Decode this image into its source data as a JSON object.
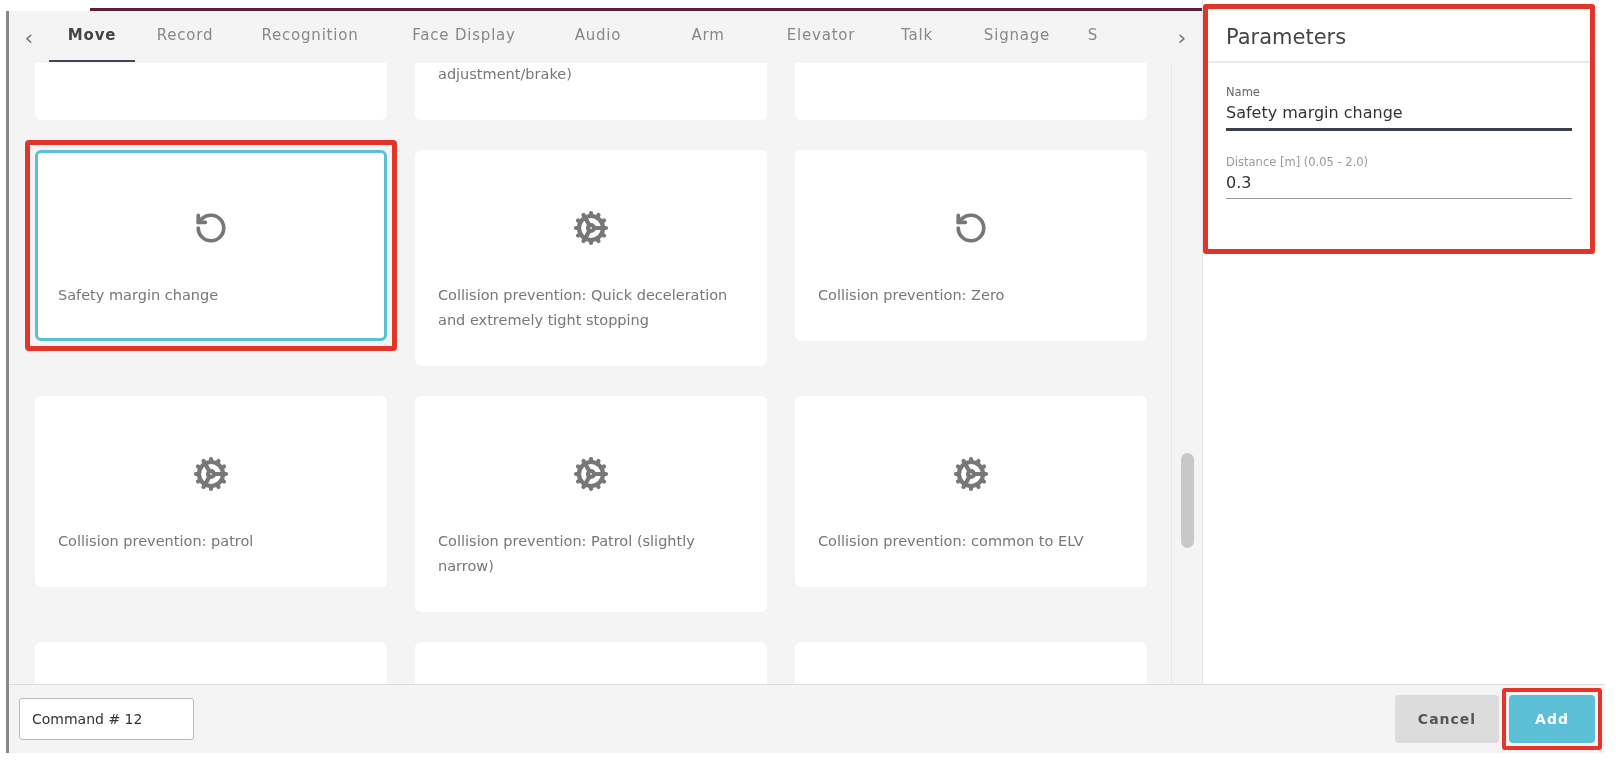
{
  "tabs": [
    {
      "label": "Move",
      "selected": true
    },
    {
      "label": "Record",
      "selected": false
    },
    {
      "label": "Recognition",
      "selected": false
    },
    {
      "label": "Face Display",
      "selected": false
    },
    {
      "label": "Audio",
      "selected": false
    },
    {
      "label": "Arm",
      "selected": false
    },
    {
      "label": "Elevator",
      "selected": false
    },
    {
      "label": "Talk",
      "selected": false
    },
    {
      "label": "Signage",
      "selected": false
    },
    {
      "label": "S",
      "selected": false
    }
  ],
  "tab_nav": {
    "prev": "‹",
    "next": "›"
  },
  "cards": [
    {
      "kind": "blank",
      "selected": false,
      "highlighted": false
    },
    {
      "kind": "blank",
      "label": "adjustment/brake)",
      "selected": false,
      "highlighted": false
    },
    {
      "kind": "blank",
      "selected": false,
      "highlighted": false
    },
    {
      "kind": "reset",
      "label": "Safety margin change",
      "selected": true,
      "highlighted": true
    },
    {
      "kind": "gear",
      "label": "Collision prevention: Quick deceleration and extremely tight stopping",
      "selected": false,
      "highlighted": false
    },
    {
      "kind": "reset",
      "label": "Collision prevention: Zero",
      "selected": false,
      "highlighted": false
    },
    {
      "kind": "gear",
      "label": "Collision prevention: patrol",
      "selected": false,
      "highlighted": false
    },
    {
      "kind": "gear",
      "label": "Collision prevention: Patrol (slightly narrow)",
      "selected": false,
      "highlighted": false
    },
    {
      "kind": "gear",
      "label": "Collision prevention: common to ELV",
      "selected": false,
      "highlighted": false
    },
    {
      "kind": "blank",
      "selected": false,
      "highlighted": false
    },
    {
      "kind": "blank",
      "selected": false,
      "highlighted": false
    },
    {
      "kind": "blank",
      "selected": false,
      "highlighted": false
    }
  ],
  "parameters": {
    "title": "Parameters",
    "highlighted": true,
    "fields": [
      {
        "label": "Name",
        "value": "Safety margin change",
        "focused": true
      },
      {
        "label": "Distance [m] (0.05 - 2.0)",
        "value": "0.3",
        "focused": false
      }
    ]
  },
  "footer": {
    "command_name": "Command # 12",
    "buttons": [
      {
        "label": "Cancel",
        "kind": "secondary",
        "highlighted": false
      },
      {
        "label": "Add",
        "kind": "primary",
        "highlighted": true
      }
    ]
  }
}
